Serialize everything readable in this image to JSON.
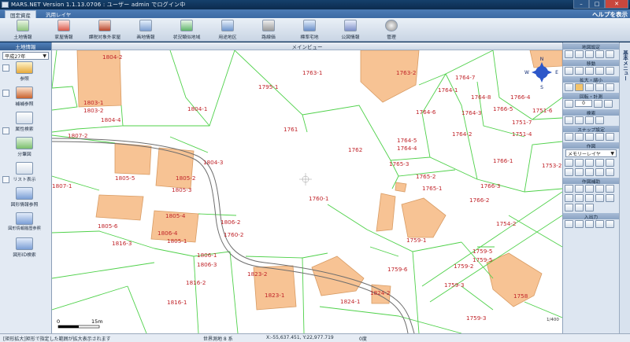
{
  "window": {
    "title": "MARS.NET Version 1.1.13.0706 : ユーザー admin でログイン中",
    "minimize": "–",
    "maximize": "□",
    "close": "✕"
  },
  "tabs": [
    {
      "label": "固定資産",
      "active": true
    },
    {
      "label": "汎用レイヤ",
      "active": false
    }
  ],
  "help_link": "ヘルプを表示",
  "toolbar": [
    {
      "label": "土地情報",
      "icon": "land-icon"
    },
    {
      "label": "家屋情報",
      "icon": "house-icon"
    },
    {
      "label": "課税対象外家屋",
      "icon": "nontax-house-icon"
    },
    {
      "label": "画地情報",
      "icon": "parcel-icon"
    },
    {
      "label": "状況類似地域",
      "icon": "similar-area-icon"
    },
    {
      "label": "用途地区",
      "icon": "zone-icon"
    },
    {
      "label": "路線価",
      "icon": "road-price-icon"
    },
    {
      "label": "標準宅地",
      "icon": "standard-lot-icon"
    },
    {
      "label": "公図情報",
      "icon": "cadastral-map-icon"
    },
    {
      "label": "管理",
      "icon": "gear-icon"
    }
  ],
  "left_panel": {
    "header": "土地情報",
    "year": "平成27年",
    "buttons": [
      {
        "label": "参照",
        "icon": "pencil-icon"
      },
      {
        "label": "補補参照",
        "icon": "book-icon"
      },
      {
        "label": "属性検索",
        "icon": "search-icon"
      },
      {
        "label": "分筆図",
        "icon": "split-map-icon"
      },
      {
        "label": "リスト表示",
        "icon": "list-icon"
      },
      {
        "label": "図形情報参照",
        "icon": "shape-icon"
      },
      {
        "label": "図形情報履歴参照",
        "icon": "history-icon"
      },
      {
        "label": "図形ID検索",
        "icon": "id-search-icon"
      }
    ]
  },
  "map": {
    "header": "メインビュー",
    "scale": {
      "zero": "0",
      "len": "15m"
    },
    "compass": {
      "n": "N",
      "s": "S",
      "e": "E",
      "w": "W"
    },
    "scale_ratio": "1/400",
    "labels": [
      {
        "t": "1804-2"
      },
      {
        "t": "1795-1"
      },
      {
        "t": "1763-1"
      },
      {
        "t": "1763-2"
      },
      {
        "t": "1764-7"
      },
      {
        "t": "1764-1"
      },
      {
        "t": "1764-8"
      },
      {
        "t": "1766-4"
      },
      {
        "t": "1766-5"
      },
      {
        "t": "1751-6"
      },
      {
        "t": "1803-1"
      },
      {
        "t": "1803-2"
      },
      {
        "t": "1804-4"
      },
      {
        "t": "1804-1"
      },
      {
        "t": "1764-6"
      },
      {
        "t": "1764-3"
      },
      {
        "t": "1751-7"
      },
      {
        "t": "1761"
      },
      {
        "t": "1807-2"
      },
      {
        "t": "1764-2"
      },
      {
        "t": "1751-4"
      },
      {
        "t": "1764-5"
      },
      {
        "t": "1764-4"
      },
      {
        "t": "1762"
      },
      {
        "t": "1804-3"
      },
      {
        "t": "1765-3"
      },
      {
        "t": "1766-1"
      },
      {
        "t": "1753-2"
      },
      {
        "t": "1805-5"
      },
      {
        "t": "1805-2"
      },
      {
        "t": "1765-2"
      },
      {
        "t": "1807-1"
      },
      {
        "t": "1805-3"
      },
      {
        "t": "1765-1"
      },
      {
        "t": "1766-3"
      },
      {
        "t": "1760-1"
      },
      {
        "t": "1766-2"
      },
      {
        "t": "1806-2"
      },
      {
        "t": "1805-4"
      },
      {
        "t": "1754-2"
      },
      {
        "t": "1805-6"
      },
      {
        "t": "1806-4"
      },
      {
        "t": "1760-2"
      },
      {
        "t": "1759-1"
      },
      {
        "t": "1816-3"
      },
      {
        "t": "1805-1"
      },
      {
        "t": "1759-5"
      },
      {
        "t": "1806-1"
      },
      {
        "t": "1759-5"
      },
      {
        "t": "1806-3"
      },
      {
        "t": "1759-2"
      },
      {
        "t": "1759-6"
      },
      {
        "t": "1823-2"
      },
      {
        "t": "1816-2"
      },
      {
        "t": "1823-1"
      },
      {
        "t": "1824-2"
      },
      {
        "t": "1759-3"
      },
      {
        "t": "1758"
      },
      {
        "t": "1816-1"
      },
      {
        "t": "1824-1"
      },
      {
        "t": "1759-3"
      }
    ]
  },
  "right_panel": {
    "sections": [
      "地図設定",
      "移動",
      "拡大・縮小",
      "回転・計測",
      "検索",
      "スナップ設定",
      "作図",
      "作図補助",
      "入出力"
    ],
    "rotation": "0",
    "layer": "メモリーレイヤ"
  },
  "vertical_tab": "基本メニュー",
  "status": {
    "message": "[矩形拡大]矩形で指定した範囲が拡大表示されます",
    "system": "世界測地 8 系",
    "coords": "X:-55,637.451, Y:22,977.719",
    "angle": "0度"
  },
  "colors": {
    "parcel_line": "#4fd14a",
    "building_fill": "#f7c394",
    "building_stroke": "#d89b63",
    "label": "#c0242a",
    "road": "#6d6d6d"
  }
}
